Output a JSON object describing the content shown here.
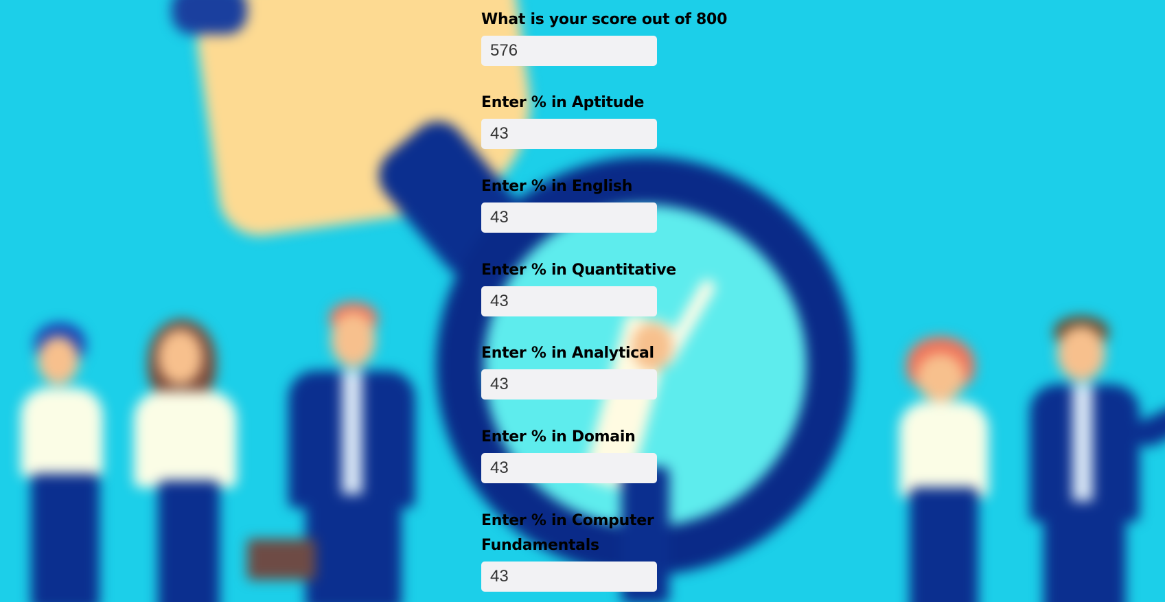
{
  "form": {
    "fields": [
      {
        "label": "What is your score out of 800",
        "value": "576"
      },
      {
        "label": "Enter % in Aptitude",
        "value": "43"
      },
      {
        "label": "Enter % in English",
        "value": "43"
      },
      {
        "label": "Enter % in Quantitative",
        "value": "43"
      },
      {
        "label": "Enter % in Analytical",
        "value": "43"
      },
      {
        "label": "Enter % in Domain",
        "value": "43"
      },
      {
        "label": "Enter % in Computer Fundamentals",
        "value": "43"
      }
    ]
  },
  "colors": {
    "background": "#1ccfe9",
    "input_background": "#f2f2f4",
    "label_text": "#000000"
  }
}
